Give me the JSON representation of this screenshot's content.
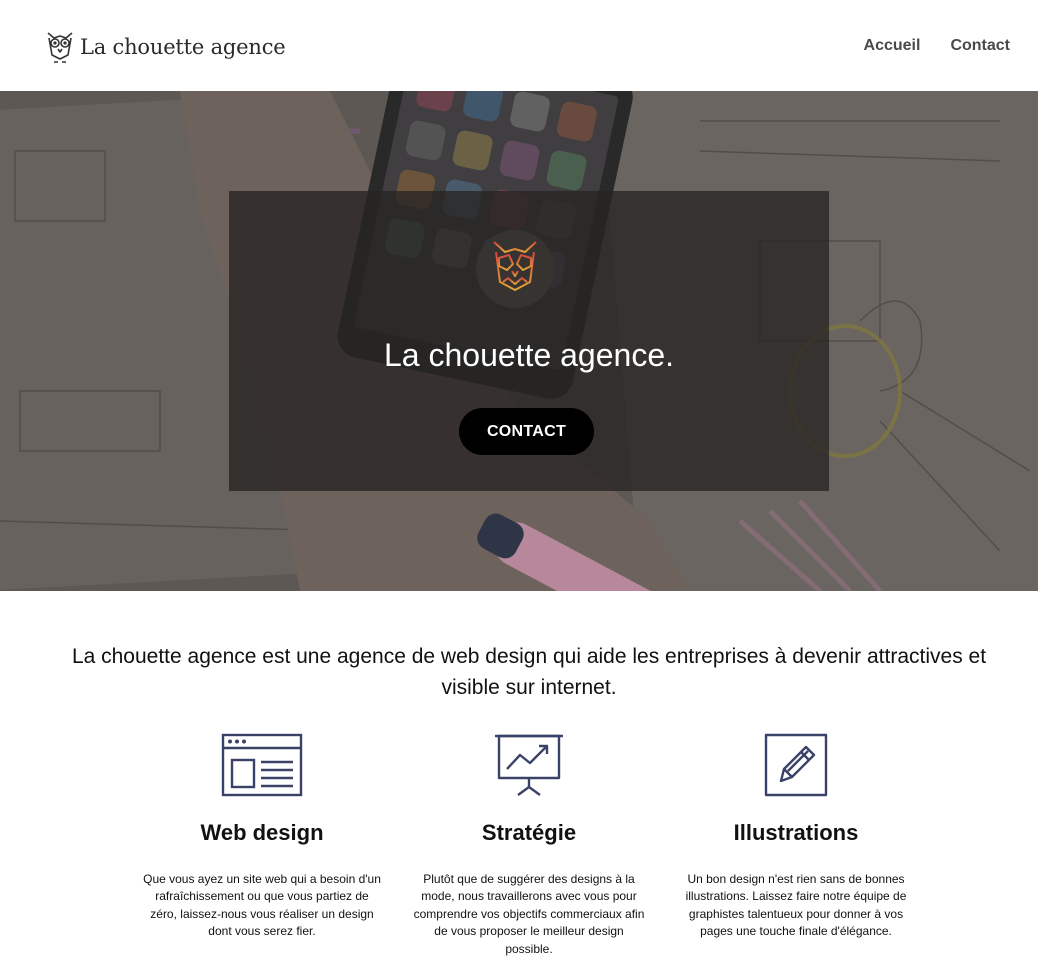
{
  "header": {
    "logo_text": "La chouette agence",
    "nav": [
      {
        "label": "Accueil"
      },
      {
        "label": "Contact"
      }
    ]
  },
  "hero": {
    "title": "La chouette agence.",
    "button_label": "CONTACT",
    "owl_icon": "owl-icon"
  },
  "intro": {
    "text": "La chouette agence est une agence de web design qui aide les entreprises à devenir attractives et visible sur internet."
  },
  "services": [
    {
      "icon": "web-browser-icon",
      "title": "Web design",
      "description": "Que vous ayez un site web qui a besoin d'un rafraîchissement ou que vous partiez de zéro, laissez-nous vous réaliser un design dont vous serez fier."
    },
    {
      "icon": "presentation-chart-icon",
      "title": "Stratégie",
      "description": "Plutôt que de suggérer des designs à la mode, nous travaillerons avec vous pour comprendre vos objectifs commerciaux afin de vous proposer le meilleur design possible."
    },
    {
      "icon": "pencil-icon",
      "title": "Illustrations",
      "description": "Un bon design n'est rien sans de bonnes illustrations. Laissez faire notre équipe de graphistes talentueux pour donner à vos pages une touche finale d'élégance."
    }
  ],
  "colors": {
    "icon_stroke": "#3b4268",
    "overlay": "#262423",
    "button": "#000000"
  }
}
